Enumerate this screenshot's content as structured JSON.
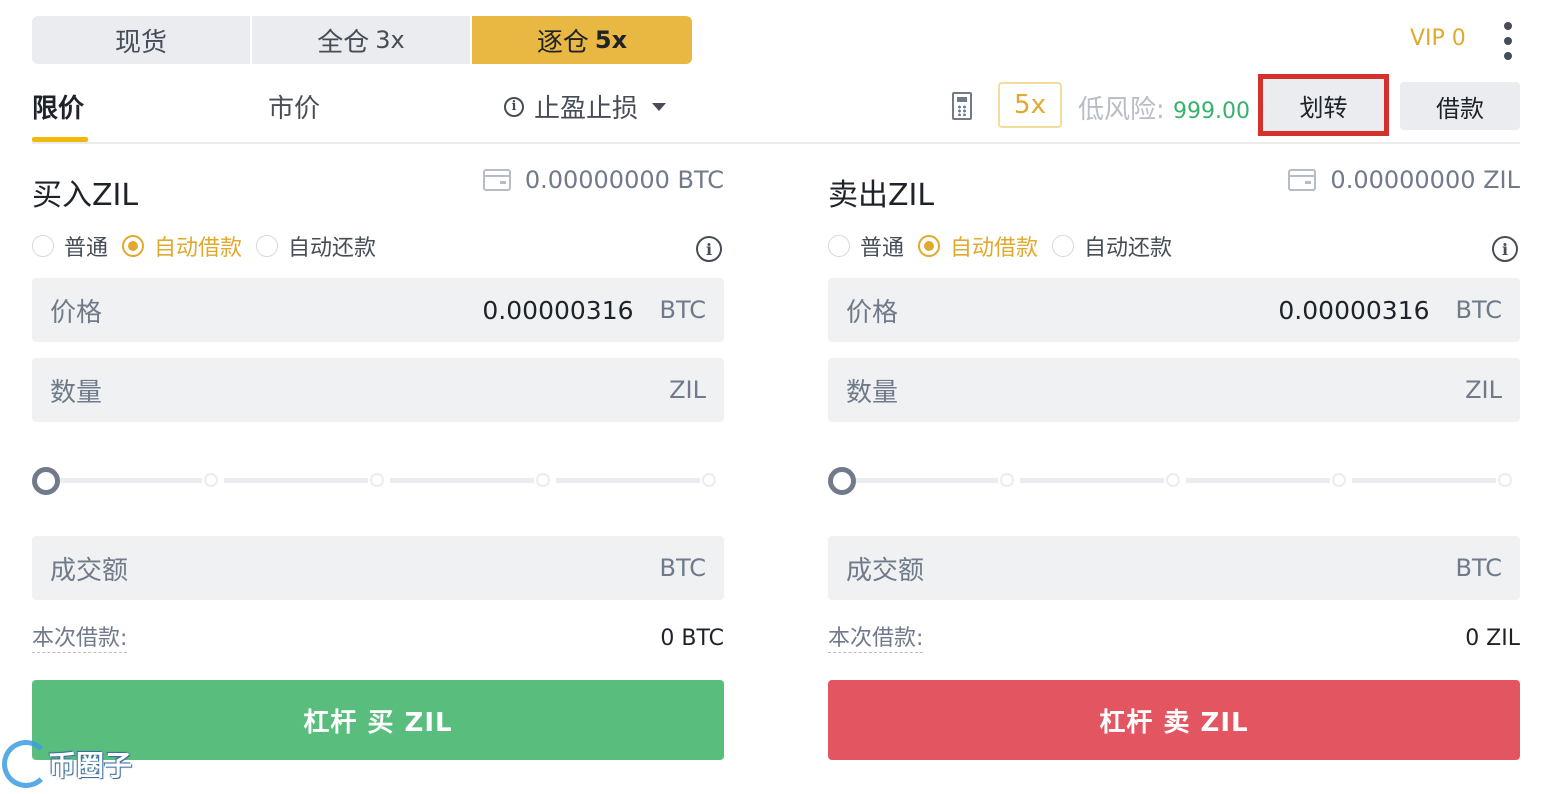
{
  "mode_tabs": [
    {
      "label": "现货",
      "leverage": ""
    },
    {
      "label": "全仓",
      "leverage": "3x"
    },
    {
      "label": "逐仓",
      "leverage": "5x"
    }
  ],
  "active_mode": 2,
  "vip_label": "VIP 0",
  "order_tabs": {
    "limit": "限价",
    "market": "市价",
    "tpsl": "止盈止损"
  },
  "leverage_badge": "5x",
  "risk": {
    "label": "低风险:",
    "value": "999.00"
  },
  "transfer_label": "划转",
  "borrow_label": "借款",
  "buy": {
    "title": "买入ZIL",
    "balance": "0.00000000 BTC",
    "modes": [
      "普通",
      "自动借款",
      "自动还款"
    ],
    "selected_mode": "自动借款",
    "price": {
      "label": "价格",
      "value": "0.00000316",
      "unit": "BTC"
    },
    "amount": {
      "label": "数量",
      "unit": "ZIL"
    },
    "total": {
      "label": "成交额",
      "unit": "BTC"
    },
    "slider_percent": 0,
    "loan_label": "本次借款:",
    "loan_value": "0 BTC",
    "button": "杠杆 买 ZIL"
  },
  "sell": {
    "title": "卖出ZIL",
    "balance": "0.00000000 ZIL",
    "modes": [
      "普通",
      "自动借款",
      "自动还款"
    ],
    "selected_mode": "自动借款",
    "price": {
      "label": "价格",
      "value": "0.00000316",
      "unit": "BTC"
    },
    "amount": {
      "label": "数量",
      "unit": "ZIL"
    },
    "total": {
      "label": "成交额",
      "unit": "BTC"
    },
    "slider_percent": 0,
    "loan_label": "本次借款:",
    "loan_value": "0 ZIL",
    "button": "杠杆 卖 ZIL"
  },
  "watermark": "币圈子",
  "colors": {
    "accent": "#f0b90b",
    "buy": "#58bd7d",
    "sell": "#e35561",
    "highlight": "#d4312c",
    "positive": "#37b26c"
  },
  "icons": [
    "info-icon",
    "caret-down-icon",
    "calculator-icon",
    "wallet-icon",
    "more-vertical-icon"
  ]
}
